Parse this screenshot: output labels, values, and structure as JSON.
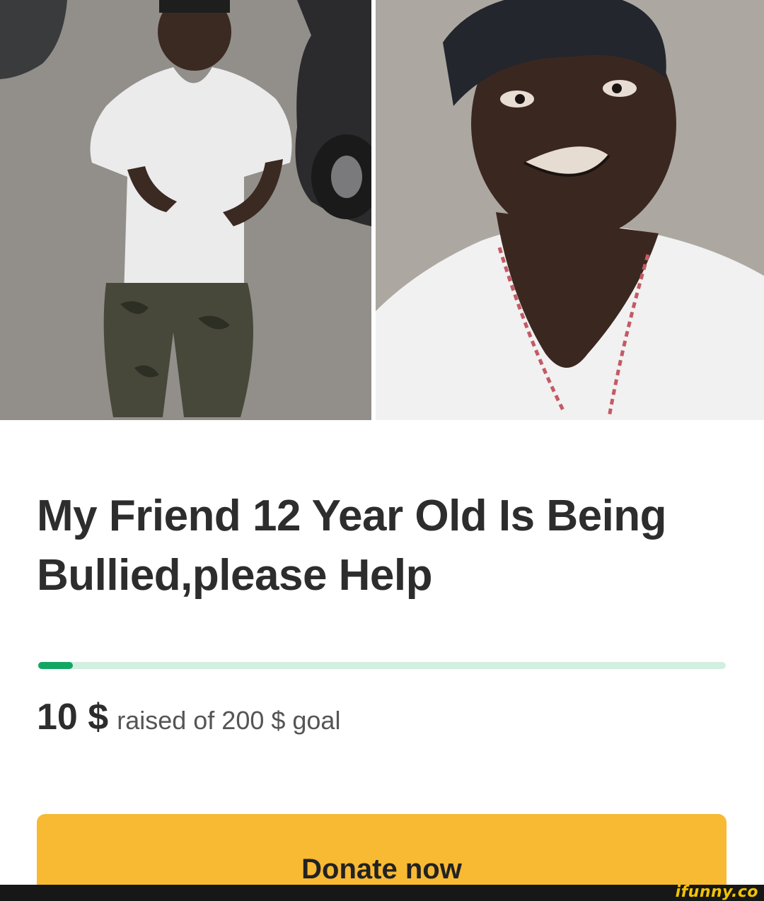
{
  "photos": [
    {
      "name": "full-body-photo"
    },
    {
      "name": "closeup-photo"
    }
  ],
  "campaign": {
    "title": "My Friend 12 Year Old Is Being Bullied,please Help",
    "raised_amount": "10 $",
    "raised_text": "raised of 200 $ goal",
    "progress_fraction": 0.05,
    "donate_label": "Donate now"
  },
  "colors": {
    "progress_fill": "#13a663",
    "progress_track": "#d3efe1",
    "donate_button": "#f8b933",
    "title_text": "#2d2d2d"
  },
  "footer": {
    "watermark": "ifunny.co"
  }
}
